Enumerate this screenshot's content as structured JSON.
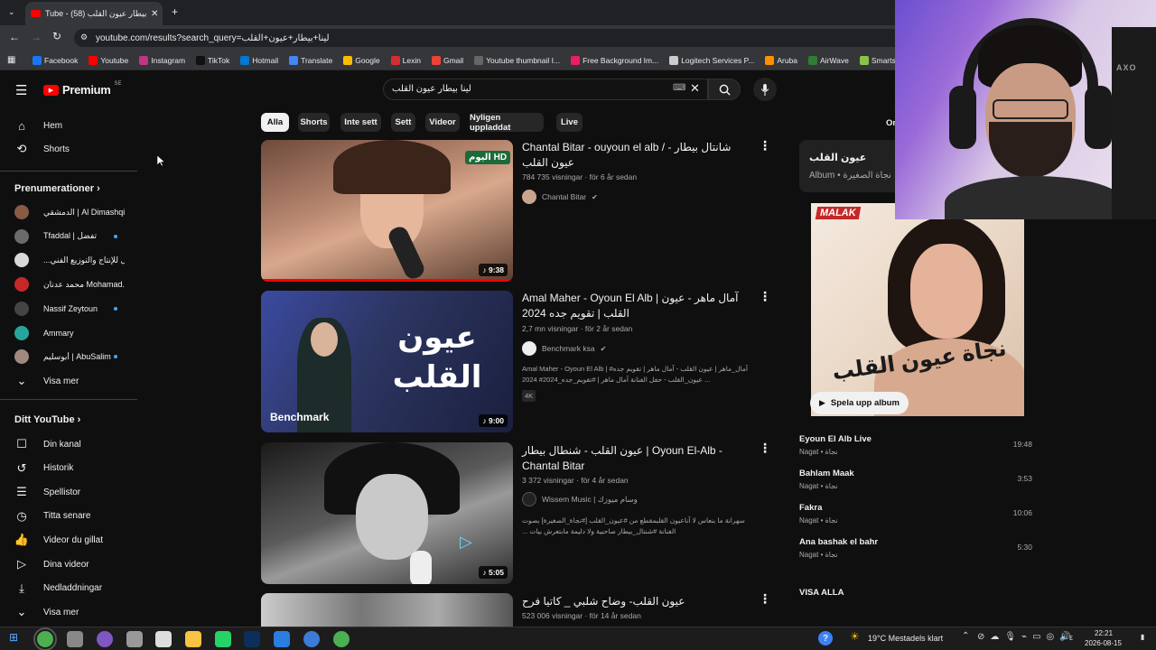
{
  "browser": {
    "tab_title": "Tube - لينا بيطار عيون القلب (58)",
    "url": "youtube.com/results?search_query=لينا+بيطار+عيون+القلب",
    "bookmarks": [
      "Facebook",
      "Youtube",
      "Instagram",
      "TikTok",
      "Hotmail",
      "Translate",
      "Google",
      "Lexin",
      "Gmail",
      "Youtube thumbnail I...",
      "Free Background Im...",
      "Logitech Services P...",
      "Aruba",
      "AirWave",
      "Smartsign Publ"
    ]
  },
  "header": {
    "logo": "Premium",
    "region": "SE",
    "search_value": "لينا بيطار عيون القلب"
  },
  "sidebar": {
    "main": [
      {
        "label": "Hem",
        "icon": "home-icon"
      },
      {
        "label": "Shorts",
        "icon": "shorts-icon"
      }
    ],
    "subs_heading": "Prenumerationer",
    "subs": [
      {
        "label": "الدمشقي | Al Dimashqi",
        "color": "#8a5a44",
        "dot": false
      },
      {
        "label": "Tfaddal | تفضل",
        "color": "#6b6b6b",
        "dot": true
      },
      {
        "label": "...ل للإنتاج والتوزيع الفني",
        "color": "#d9d9d9",
        "dot": false
      },
      {
        "label": "محمد عدنان Mohamad...",
        "color": "#c62828",
        "dot": false
      },
      {
        "label": "Nassif Zeytoun",
        "color": "#444",
        "dot": true
      },
      {
        "label": "Ammary",
        "color": "#26a69a",
        "dot": false
      },
      {
        "label": "أبوسليم | AbuSalim",
        "color": "#a1887f",
        "dot": true
      }
    ],
    "show_more": "Visa mer",
    "you_heading": "Ditt YouTube",
    "you": [
      {
        "label": "Din kanal",
        "icon": "channel-icon"
      },
      {
        "label": "Historik",
        "icon": "history-icon"
      },
      {
        "label": "Spellistor",
        "icon": "playlists-icon"
      },
      {
        "label": "Titta senare",
        "icon": "watch-later-icon"
      },
      {
        "label": "Videor du gillat",
        "icon": "like-icon"
      },
      {
        "label": "Dina videor",
        "icon": "your-videos-icon"
      },
      {
        "label": "Nedladdningar",
        "icon": "download-icon"
      }
    ],
    "show_more_2": "Visa mer"
  },
  "chips": [
    "Alla",
    "Shorts",
    "Inte sett",
    "Sett",
    "Videor",
    "Nyligen uppladdat",
    "Live"
  ],
  "chips_more": "Om",
  "results": [
    {
      "title": "Chantal Bitar - ouyoun el alb / شانتال بيطار - عيون القلب",
      "meta": "784 735 visningar · för 6 år sedan",
      "channel": "Chantal Bitar",
      "verified": true,
      "description": "",
      "badge": "",
      "duration": "9:38",
      "thumb_overlay": "اليوم HD",
      "thumb_bg": "#9a6a52"
    },
    {
      "title": "Amal Maher - Oyoun El Alb | آمال ماهر - عيون القلب | تقويم جده 2024",
      "meta": "2,7 mn visningar · för 2 år sedan",
      "channel": "Benchmark ksa",
      "verified": true,
      "description": "Amal Maher - Oyoun El Alb | #آمال_ماهر | عيون القلب - آمال ماهر | تقويم جده 2024 ‎#عيون_القلب - حفل الفنانة آمال ماهر | #تقويم_جده_2024 ...",
      "badge": "4K",
      "duration": "9:00",
      "thumb_overlay": "Benchmark",
      "thumb_text": "عيون القلب",
      "thumb_bg": "#2c3560"
    },
    {
      "title": "عيون القلب - شنطال بيطار | Oyoun El-Alb - Chantal Bitar",
      "meta": "3 372 visningar · för 4 år sedan",
      "channel": "Wissem Music | وسام ميوزك",
      "verified": false,
      "description": "سهرانة ما بنعاس لا آناعيون القلبمقطع من #عيون_القلب [#نجاة_الصغيرة] بصوت الفنانة #شنتال_بيطار صاحبية ولا دليمة مابتعرش بيات ...",
      "badge": "",
      "duration": "5:05",
      "thumb_bg": "#3a3a3a"
    },
    {
      "title": "عيون القلب- وضاح شلبي _ كاتيا فرح",
      "meta": "523 006 visningar · för 14 år sedan",
      "channel": "",
      "verified": false,
      "description": "",
      "badge": "",
      "duration": "",
      "thumb_bg": "#8a8a8a"
    }
  ],
  "album": {
    "title": "عيون القلب",
    "subtitle": "Album • نجاة الصغيرة",
    "cover_text": "نجاة عيون القلب",
    "label_logo": "MALAK",
    "play_label": "Spela upp album",
    "tracks": [
      {
        "name": "Eyoun El Alb Live",
        "artist": "Nagat • نجاة",
        "duration": "19:48"
      },
      {
        "name": "Bahlam Maak",
        "artist": "Nagat • نجاة",
        "duration": "3:53"
      },
      {
        "name": "Fakra",
        "artist": "Nagat • نجاة",
        "duration": "10:06"
      },
      {
        "name": "Ana bashak el bahr",
        "artist": "Nagat • نجاة",
        "duration": "5:30"
      }
    ],
    "see_all": "VISA ALLA"
  },
  "taskbar": {
    "weather": "19°C  Mestadels klart",
    "time": "22:21",
    "date": "2026-08-15",
    "lang": "ε"
  },
  "webcam_brand": "AXO",
  "colors": {
    "accent_red": "#ff0000",
    "link_blue": "#3ea6ff",
    "bg": "#0f0f0f"
  }
}
